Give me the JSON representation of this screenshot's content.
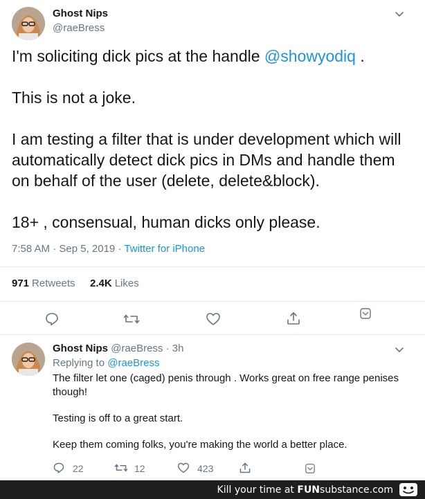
{
  "tweet": {
    "display_name": "Ghost Nips",
    "handle": "@raeBress",
    "text_part1": "I'm soliciting dick pics at the handle ",
    "mention": "@showyodiq",
    "text_part1_end": " .",
    "text_line2": "This is not a joke.",
    "text_line3": "I am testing a filter that is under development which will automatically detect dick pics in DMs and handle them on behalf of the user (delete, delete&block).",
    "text_line4": "18+ , consensual, human dicks only please.",
    "time": "7:58 AM · Sep 5, 2019 · ",
    "client": "Twitter for iPhone",
    "retweets_count": "971",
    "retweets_label": "Retweets",
    "likes_count": "2.4K",
    "likes_label": "Likes"
  },
  "reply": {
    "display_name": "Ghost Nips",
    "handle_time": "@raeBress · 3h",
    "replying_prefix": "Replying to ",
    "replying_to": "@raeBress",
    "para1": "The filter let one (caged) penis through . Works great on free range penises though!",
    "para2": "Testing is off to a great start.",
    "para3": "Keep them coming folks, you're making the world a better place.",
    "reply_count": "22",
    "retweet_count": "12",
    "like_count": "423"
  },
  "footer": {
    "prefix": "Kill your time at ",
    "brand_fun": "FUN",
    "brand_rest": "substance",
    "domain": ".com"
  },
  "icons": [
    "chevron-down-icon",
    "reply-icon",
    "retweet-icon",
    "like-icon",
    "share-icon",
    "caret-box-icon"
  ],
  "colors": {
    "link": "#1b95e0",
    "muted": "#657786",
    "text": "#14171a",
    "divider": "#e6ecf0",
    "footer": "#1f1f1f"
  }
}
